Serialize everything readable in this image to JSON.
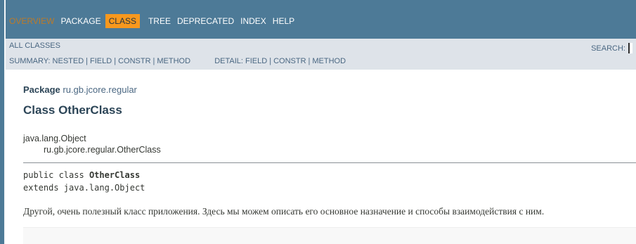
{
  "topnav": {
    "items": [
      {
        "label": "Overview",
        "state": "disabled"
      },
      {
        "label": "Package",
        "state": "link"
      },
      {
        "label": "Class",
        "state": "current"
      },
      {
        "label": "Tree",
        "state": "link"
      },
      {
        "label": "Deprecated",
        "state": "link"
      },
      {
        "label": "Index",
        "state": "link"
      },
      {
        "label": "Help",
        "state": "link"
      }
    ]
  },
  "subnav": {
    "all_classes": "All Classes",
    "summary_label": "Summary:",
    "summary_items": [
      "Nested",
      "Field",
      "Constr",
      "Method"
    ],
    "detail_label": "Detail:",
    "detail_items": [
      "Field",
      "Constr",
      "Method"
    ],
    "search_label": "SEARCH:",
    "search_value": ""
  },
  "header": {
    "package_label": "Package",
    "package_name": "ru.gb.jcore.regular",
    "class_title": "Class OtherClass"
  },
  "inheritance": {
    "parent": "java.lang.Object",
    "child": "ru.gb.jcore.regular.OtherClass"
  },
  "signature": {
    "modifiers": "public class",
    "class_name": "OtherClass",
    "extends_line": "extends java.lang.Object"
  },
  "description": "Другой, очень полезный класс приложения. Здесь мы можем описать его основное назначение и способы взаимодействия с ним.",
  "colors": {
    "nav_bg": "#4d7a97",
    "subnav_bg": "#dee3e9",
    "current_tab_bg": "#f8981d",
    "title_color": "#2c4557",
    "link_color": "#4a6782"
  }
}
